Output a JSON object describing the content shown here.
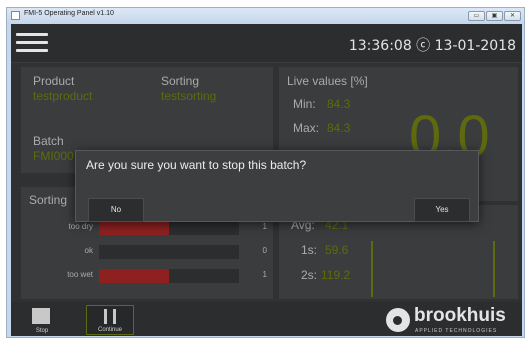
{
  "window": {
    "title": "FMI-5 Operating Panel v1.10",
    "min_glyph": "▭",
    "max_glyph": "▣",
    "close_glyph": "✕"
  },
  "header": {
    "clock": "13:36:08 ⓒ 13-01-2018"
  },
  "product_panel": {
    "product_label": "Product",
    "product_value": "testproduct",
    "sorting_label": "Sorting",
    "sorting_value": "testsorting",
    "batch_label": "Batch",
    "batch_value": "FMI000"
  },
  "live_panel": {
    "title": "Live values [%]",
    "min_label": "Min:",
    "min_value": "84.3",
    "max_label": "Max:",
    "max_value": "84.3",
    "big_value": "0.0"
  },
  "sorting_panel": {
    "title": "Sorting",
    "rows": [
      {
        "label": "too dry",
        "count": "1",
        "fill": 0.5
      },
      {
        "label": "ok",
        "count": "0",
        "fill": 0
      },
      {
        "label": "too wet",
        "count": "1",
        "fill": 0.5
      }
    ]
  },
  "stats_panel": {
    "avg_label": "Avg:",
    "avg_value": "42.1",
    "s1_label": "1s:",
    "s1_value": "59.6",
    "s2_label": "2s:",
    "s2_value": "119.2"
  },
  "controls": {
    "stop_label": "Stop",
    "continue_label": "Continue"
  },
  "brand": {
    "name": "brookhuis",
    "sub": "APPLIED TECHNOLOGIES"
  },
  "dialog": {
    "message": "Are you sure you want to stop this batch?",
    "no_label": "No",
    "yes_label": "Yes"
  },
  "colors": {
    "background": "#2f3133",
    "panel": "#3a3c3e",
    "value_olive": "#5f6a0f",
    "bar_red": "#8e2020"
  }
}
